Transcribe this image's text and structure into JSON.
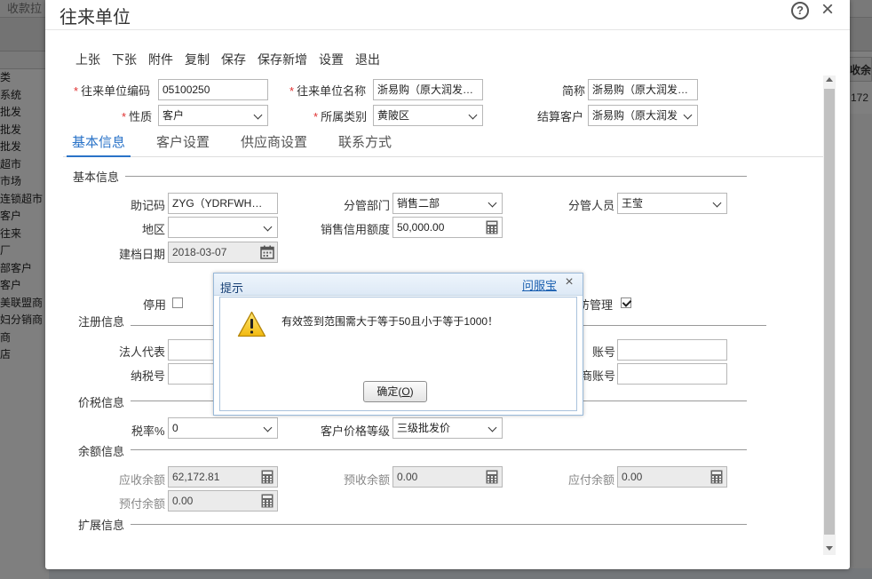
{
  "background": {
    "tab": "收款拉",
    "left_items": [
      "类",
      "系统",
      "批发",
      "批发",
      "批发",
      "超市",
      "市场",
      "连锁超市",
      "客户",
      "往来",
      "厂",
      "部客户",
      "客户",
      "美联盟商",
      "妇分销商",
      "商",
      "店"
    ],
    "right_header": "收余额",
    "right_cell": "172"
  },
  "dialog": {
    "title": "往来单位",
    "help_icon": "?",
    "close_icon": "×"
  },
  "toolbar": {
    "buttons": [
      "上张",
      "下张",
      "附件",
      "复制",
      "保存",
      "保存新增",
      "设置",
      "退出"
    ]
  },
  "header_form": {
    "code_label": "往来单位编码",
    "code_value": "05100250",
    "name_label": "往来单位名称",
    "name_value": "浙易购（原大润发…",
    "short_label": "简称",
    "short_value": "浙易购（原大润发…",
    "nature_label": "性质",
    "nature_value": "客户",
    "category_label": "所属类别",
    "category_value": "黄陂区",
    "settle_label": "结算客户",
    "settle_value": "浙易购（原大润发"
  },
  "tabs": [
    "基本信息",
    "客户设置",
    "供应商设置",
    "联系方式"
  ],
  "basic": {
    "section": "基本信息",
    "mnemonic_label": "助记码",
    "mnemonic_value": "ZYG（YDRFWH…",
    "dept_label": "分管部门",
    "dept_value": "销售二部",
    "staff_label": "分管人员",
    "staff_value": "王莹",
    "region_label": "地区",
    "region_value": "",
    "credit_label": "销售信用额度",
    "credit_value": "50,000.00",
    "date_label": "建档日期",
    "date_value": "2018-03-07",
    "disable_label": "停用",
    "visit_label": "访管理"
  },
  "register": {
    "section": "注册信息",
    "legal_label": "法人代表",
    "account_label": "账号",
    "tax_label": "纳税号",
    "tax_account_label": "商账号"
  },
  "tax": {
    "section": "价税信息",
    "rate_label": "税率%",
    "rate_value": "0",
    "price_level_label": "客户价格等级",
    "price_level_value": "三级批发价"
  },
  "balance": {
    "section": "余额信息",
    "receivable_label": "应收余额",
    "receivable_value": "62,172.81",
    "prereceive_label": "预收余额",
    "prereceive_value": "0.00",
    "payable_label": "应付余额",
    "payable_value": "0.00",
    "prepay_label": "预付余额",
    "prepay_value": "0.00"
  },
  "extension": {
    "section": "扩展信息"
  },
  "prompt": {
    "title": "提示",
    "link": "问服宝",
    "close": "×",
    "message": "有效签到范围需大于等于50且小于等于1000！",
    "ok_label": "确定(",
    "ok_key": "O",
    "ok_suffix": ")"
  }
}
